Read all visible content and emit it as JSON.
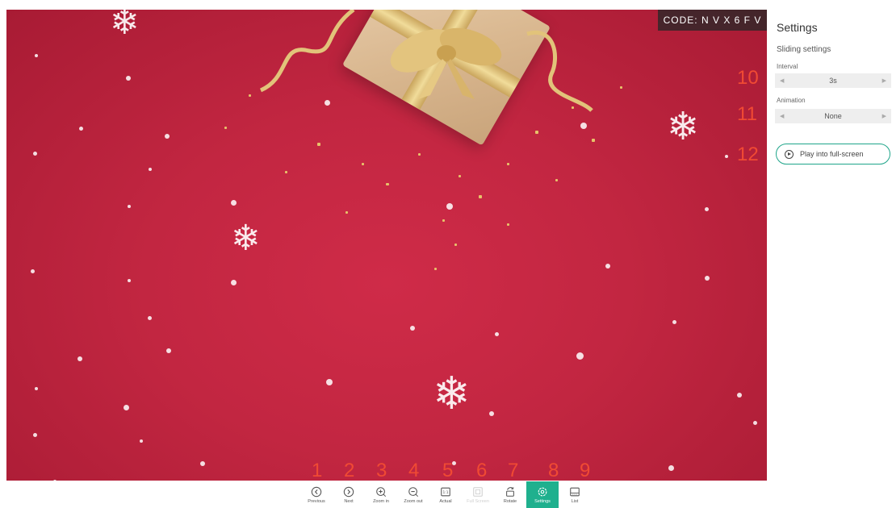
{
  "viewer": {
    "code_label": "CODE: N V X 6 F V"
  },
  "settings": {
    "title": "Settings",
    "section": "Sliding settings",
    "interval_label": "Interval",
    "interval_value": "3s",
    "animation_label": "Animation",
    "animation_value": "None",
    "play_label": "Play into full-screen"
  },
  "toolbar": {
    "items": [
      {
        "label": "Previous",
        "icon": "chevron-left-circle-icon"
      },
      {
        "label": "Next",
        "icon": "chevron-right-circle-icon"
      },
      {
        "label": "Zoom in",
        "icon": "zoom-in-icon"
      },
      {
        "label": "Zoom out",
        "icon": "zoom-out-icon"
      },
      {
        "label": "Actual",
        "icon": "actual-size-icon"
      },
      {
        "label": "Full Screen",
        "icon": "full-screen-icon",
        "state": "disabled"
      },
      {
        "label": "Rotate",
        "icon": "rotate-icon"
      },
      {
        "label": "Settings",
        "icon": "settings-icon",
        "state": "active"
      },
      {
        "label": "List",
        "icon": "list-icon"
      }
    ]
  },
  "callouts": [
    "1",
    "2",
    "3",
    "4",
    "5",
    "6",
    "7",
    "8",
    "9",
    "10",
    "11",
    "12"
  ],
  "colors": {
    "accent": "#1fb08e",
    "callout": "#f04a33",
    "background_red": "#c22641"
  }
}
